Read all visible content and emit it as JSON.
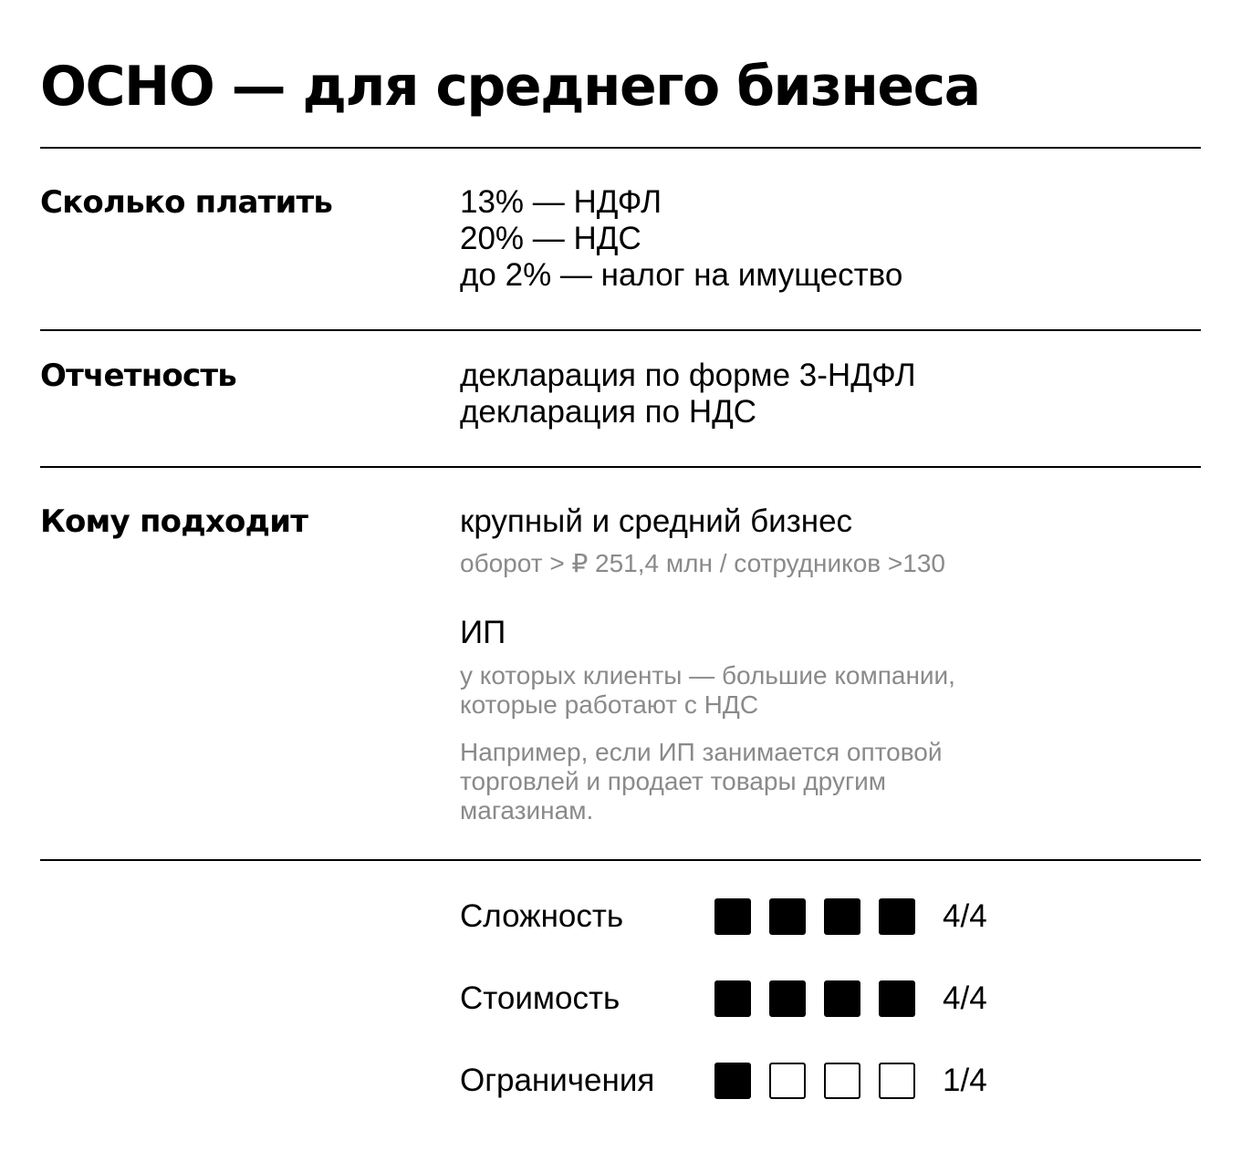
{
  "title": "ОСНО — для среднего бизнеса",
  "sections": {
    "payment": {
      "label": "Сколько платить",
      "lines": [
        "13% — НДФЛ",
        "20% — НДС",
        "до 2% — налог на имущество"
      ]
    },
    "reporting": {
      "label": "Отчетность",
      "lines": [
        "декларация по форме 3-НДФЛ",
        "декларация по НДС"
      ]
    },
    "suits": {
      "label": "Кому подходит",
      "group1": {
        "heading": "крупный и средний бизнес",
        "note": "оборот > ₽ 251,4 млн / сотрудников >130"
      },
      "group2": {
        "heading": "ИП",
        "note_lines": [
          "у которых клиенты — большие компании,",
          "которые работают с НДС"
        ],
        "example_lines": [
          "Например, если ИП занимается оптовой",
          "торговлей и продает товары другим",
          "магазинам."
        ]
      }
    }
  },
  "ratings": [
    {
      "label": "Сложность",
      "score": "4/4",
      "filled": 4,
      "total": 4
    },
    {
      "label": "Стоимость",
      "score": "4/4",
      "filled": 4,
      "total": 4
    },
    {
      "label": "Ограничения",
      "score": "1/4",
      "filled": 1,
      "total": 4
    }
  ]
}
